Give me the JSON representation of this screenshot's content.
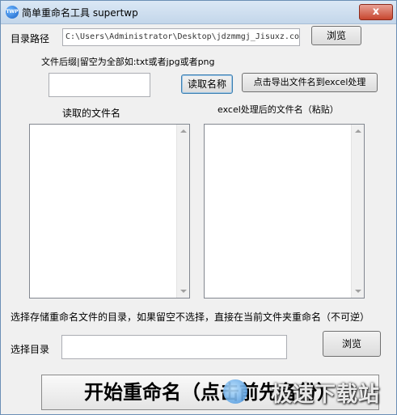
{
  "window": {
    "icon_text": "TWP",
    "title": "简单重命名工具 supertwp",
    "close_glyph": "x"
  },
  "dir_path": {
    "label": "目录路径",
    "value": "C:\\Users\\Administrator\\Desktop\\jdzmmgj_Jisuxz.com",
    "browse_label": "浏览"
  },
  "suffix": {
    "hint": "文件后缀|留空为全部如:txt或者jpg或者png",
    "value": "",
    "read_button": "读取名称",
    "export_button": "点击导出文件名到excel处理"
  },
  "lists": {
    "read_title": "读取的文件名",
    "excel_title": "excel处理后的文件名（粘贴）"
  },
  "target": {
    "hint": "选择存储重命名文件的目录，如果留空不选择，直接在当前文件夹重命名（不可逆）",
    "label": "选择目录",
    "value": "",
    "browse_label": "浏览"
  },
  "start_button": "开始重命名（点击前先备份）",
  "watermark": "极速下载站",
  "icons": {
    "app": "app-logo-icon",
    "close": "close-icon",
    "scroll_up": "scroll-up-arrow-icon",
    "scroll_down": "scroll-down-arrow-icon"
  }
}
